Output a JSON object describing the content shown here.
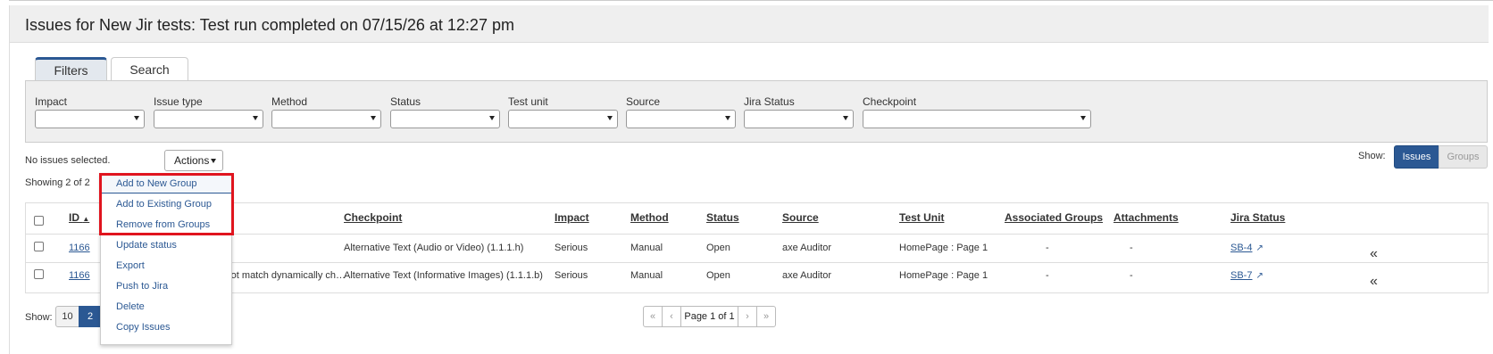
{
  "page_title": "Issues for New Jir tests: Test run completed on 07/15/26 at 12:27 pm",
  "tabs": [
    {
      "label": "Filters",
      "active": true
    },
    {
      "label": "Search",
      "active": false
    }
  ],
  "filters": [
    {
      "label": "Impact",
      "value": ""
    },
    {
      "label": "Issue type",
      "value": ""
    },
    {
      "label": "Method",
      "value": ""
    },
    {
      "label": "Status",
      "value": ""
    },
    {
      "label": "Test unit",
      "value": ""
    },
    {
      "label": "Source",
      "value": ""
    },
    {
      "label": "Jira Status",
      "value": ""
    },
    {
      "label": "Checkpoint",
      "value": ""
    }
  ],
  "selection_text": "No issues selected.",
  "actions_label": "Actions",
  "showing_text": "Showing 2 of 2",
  "show_label": "Show:",
  "view_toggle": {
    "issues": "Issues",
    "groups": "Groups",
    "selected": "Issues"
  },
  "table": {
    "headers": {
      "id": "ID",
      "checkpoint": "Checkpoint",
      "impact": "Impact",
      "method": "Method",
      "status": "Status",
      "source": "Source",
      "test_unit": "Test Unit",
      "associated_groups": "Associated Groups",
      "attachments": "Attachments",
      "jira_status": "Jira Status"
    },
    "rows": [
      {
        "id": "1166",
        "description": "",
        "checkpoint": "Alternative Text (Audio or Video) (1.1.1.h)",
        "impact": "Serious",
        "method": "Manual",
        "status": "Open",
        "source": "axe Auditor",
        "test_unit": "HomePage : Page 1",
        "associated_groups": "-",
        "attachments": "-",
        "jira": "SB-4"
      },
      {
        "id": "1166",
        "description": "s not match dynamically ch…",
        "checkpoint": "Alternative Text (Informative Images) (1.1.1.b)",
        "impact": "Serious",
        "method": "Manual",
        "status": "Open",
        "source": "axe Auditor",
        "test_unit": "HomePage : Page 1",
        "associated_groups": "-",
        "attachments": "-",
        "jira": "SB-7"
      }
    ]
  },
  "actions_menu": [
    "Add to New Group",
    "Add to Existing Group",
    "Remove from Groups",
    "Update status",
    "Export",
    "Push to Jira",
    "Delete",
    "Copy Issues"
  ],
  "page_size": {
    "label": "Show:",
    "options": [
      "10",
      "2"
    ],
    "selected": "2"
  },
  "pagination": {
    "first": "«",
    "prev": "‹",
    "text": "Page 1 of 1",
    "next": "›",
    "last": "»"
  },
  "colors": {
    "primary": "#2b5893",
    "highlight": "#e0141e"
  }
}
